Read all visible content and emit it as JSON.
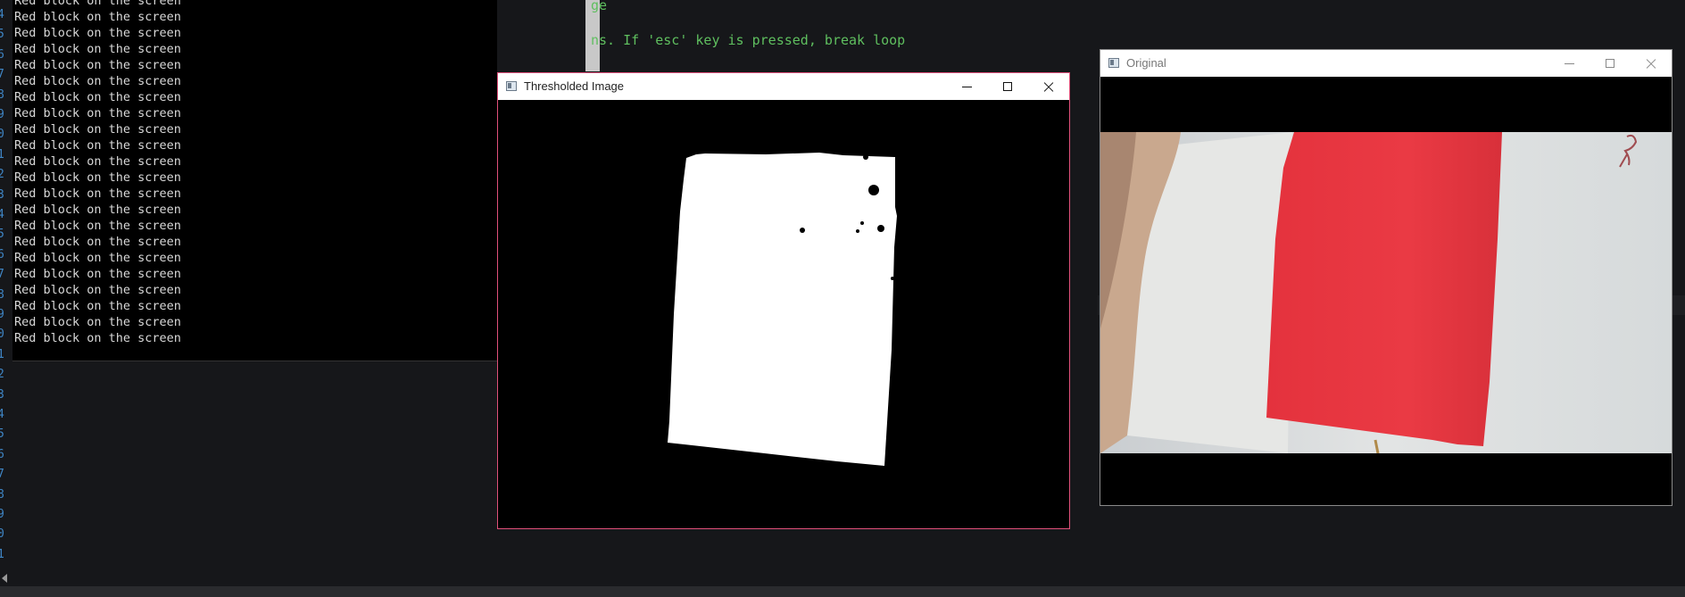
{
  "editor": {
    "line_numbers": [
      "4",
      "5",
      "6",
      "7",
      "8",
      "9",
      "0",
      "1",
      "2",
      "3",
      "4",
      "5",
      "6",
      "7",
      "8",
      "9",
      "0",
      "1",
      "2",
      "3",
      "4",
      "5",
      "6",
      "7",
      "8",
      "9",
      "0",
      "1"
    ],
    "code_line_1": "ge",
    "code_line_2": "ns. If 'esc' key is pressed, break loop"
  },
  "console": {
    "lines": [
      "Red block on the screen",
      "Red block on the screen",
      "Red block on the screen",
      "Red block on the screen",
      "Red block on the screen",
      "Red block on the screen",
      "Red block on the screen",
      "Red block on the screen",
      "Red block on the screen",
      "Red block on the screen",
      "Red block on the screen",
      "Red block on the screen",
      "Red block on the screen",
      "Red block on the screen",
      "Red block on the screen",
      "Red block on the screen",
      "Red block on the screen",
      "Red block on the screen",
      "Red block on the screen",
      "Red block on the screen",
      "Red block on the screen",
      "Red block on the screen"
    ]
  },
  "windows": {
    "thresholded": {
      "title": "Thresholded Image"
    },
    "original": {
      "title": "Original"
    }
  },
  "colors": {
    "accent_border": "#e0507a",
    "red_paper": "#e8343f",
    "code_green": "#5fbf5f",
    "line_number_blue": "#3f86c6"
  },
  "icons": [
    "window-app-icon",
    "minimize-icon",
    "maximize-icon",
    "close-icon"
  ]
}
